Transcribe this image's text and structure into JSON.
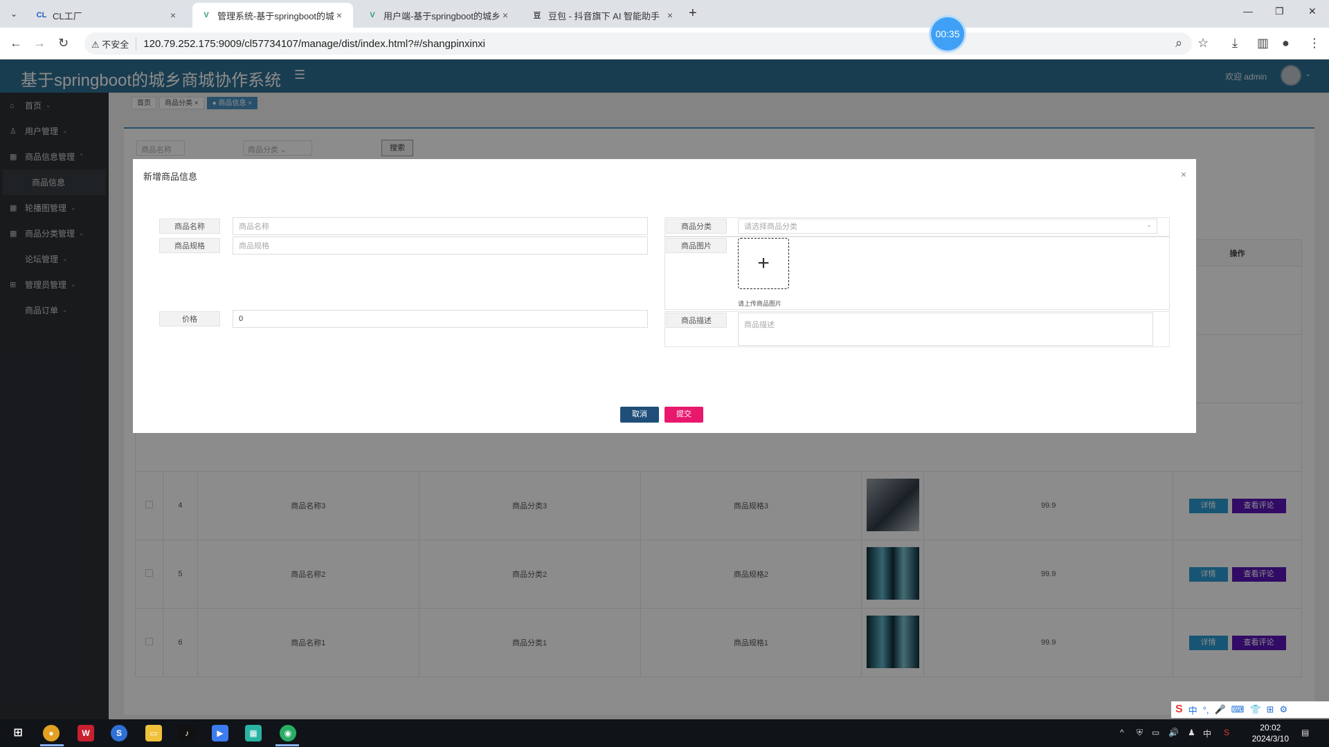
{
  "browser": {
    "tabs": [
      {
        "favicon": "CL",
        "title": "CL工厂",
        "active": false
      },
      {
        "favicon": "V",
        "title": "管理系统-基于springboot的城",
        "active": true
      },
      {
        "favicon": "V",
        "title": "用户端-基于springboot的城乡",
        "active": false
      },
      {
        "favicon": "豆",
        "title": "豆包 - 抖音旗下 AI 智能助手",
        "active": false
      }
    ],
    "security_label": "不安全",
    "url": "120.79.252.175:9009/cl57734107/manage/dist/index.html?#/shangpinxinxi",
    "timer": "00:35"
  },
  "app": {
    "title": "基于springboot的城乡商城协作系统",
    "welcome": "欢迎 admin"
  },
  "sidebar": {
    "items": [
      {
        "icon": "home-icon",
        "label": "首页"
      },
      {
        "icon": "user-icon",
        "label": "用户管理"
      },
      {
        "icon": "grid-icon",
        "label": "商品信息管理"
      },
      {
        "icon": "",
        "label": "商品信息"
      },
      {
        "icon": "grid-icon",
        "label": "轮播图管理"
      },
      {
        "icon": "grid-icon",
        "label": "商品分类管理"
      },
      {
        "icon": "",
        "label": "论坛管理"
      },
      {
        "icon": "apps-icon",
        "label": "管理员管理"
      },
      {
        "icon": "",
        "label": "商品订单"
      }
    ]
  },
  "breadcrumbs": [
    "首页",
    "商品分类",
    "商品信息"
  ],
  "search": {
    "name_placeholder": "商品名称",
    "category_placeholder": "商品分类",
    "button": "搜索"
  },
  "table": {
    "action_header": "操作",
    "rows": [
      {
        "id": "4",
        "name": "商品名称3",
        "category": "商品分类3",
        "spec": "商品规格3",
        "price": "99.9"
      },
      {
        "id": "5",
        "name": "商品名称2",
        "category": "商品分类2",
        "spec": "商品规格2",
        "price": "99.9"
      },
      {
        "id": "6",
        "name": "商品名称1",
        "category": "商品分类1",
        "spec": "商品规格1",
        "price": "99.9"
      }
    ],
    "detail_button": "详情",
    "review_button": "查看评论"
  },
  "modal": {
    "title": "新增商品信息",
    "fields": {
      "name_label": "商品名称",
      "name_placeholder": "商品名称",
      "spec_label": "商品规格",
      "spec_placeholder": "商品规格",
      "price_label": "价格",
      "price_value": "0",
      "category_label": "商品分类",
      "category_placeholder": "请选择商品分类",
      "image_label": "商品图片",
      "image_tip": "请上传商品图片",
      "desc_label": "商品描述",
      "desc_placeholder": "商品描述"
    },
    "cancel": "取消",
    "submit": "提交"
  },
  "taskbar": {
    "time": "20:02",
    "date": "2024/3/10",
    "ime_mode": "中"
  },
  "colors": {
    "header": "#2f6f92",
    "sidebar": "#2d3034",
    "detail_button": "#2b9bd3",
    "review_button": "#5a14b8",
    "cancel_button": "#1f4e79",
    "submit_button": "#e8186d"
  }
}
